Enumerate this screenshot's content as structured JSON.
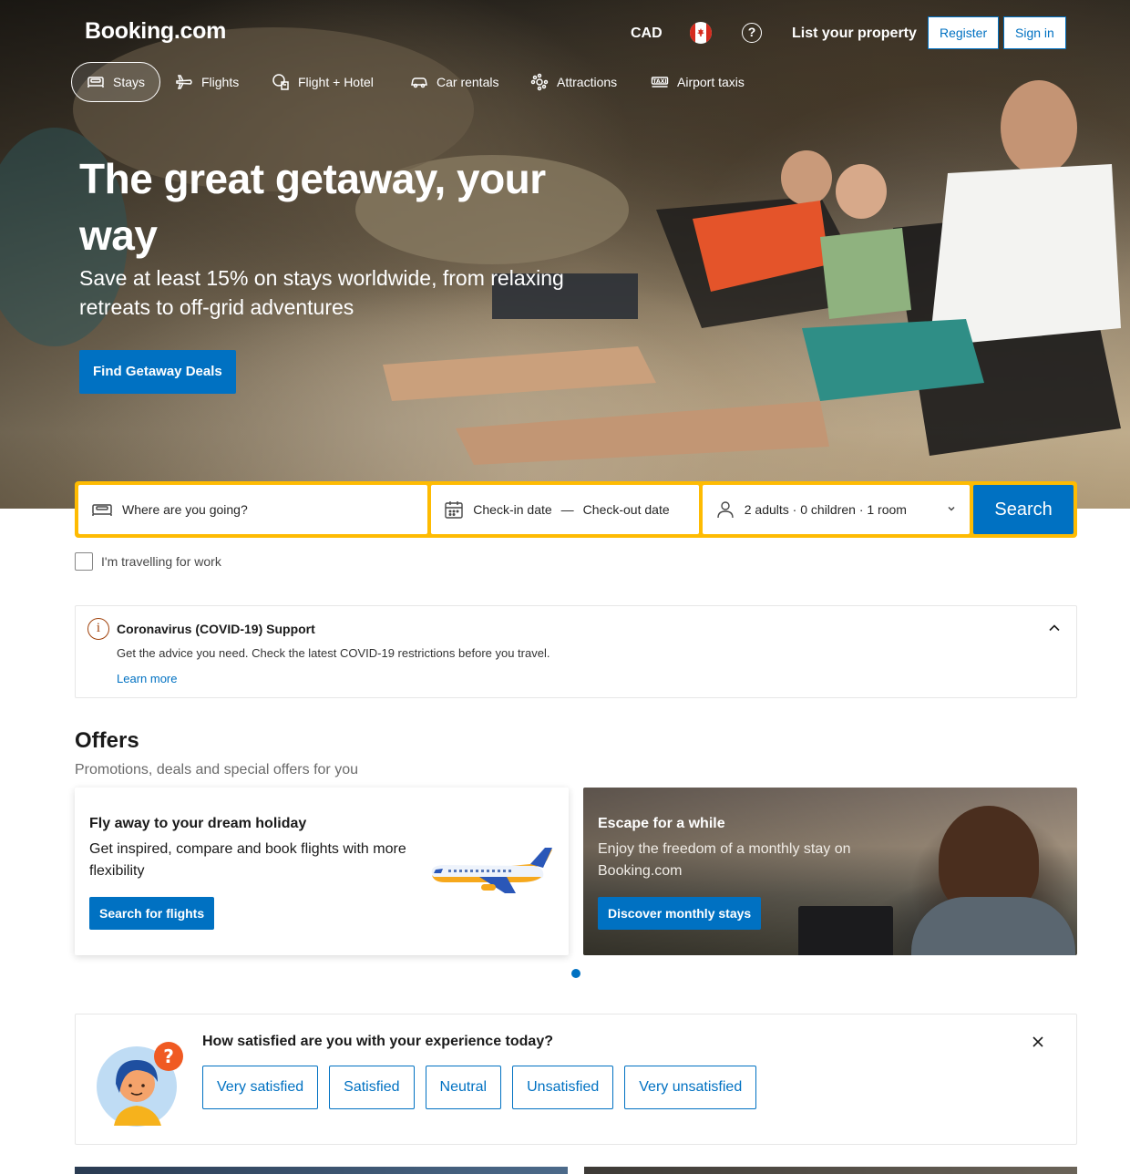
{
  "header": {
    "logo": "Booking.com",
    "currency": "CAD",
    "list_property": "List your property",
    "register": "Register",
    "sign_in": "Sign in"
  },
  "nav": {
    "items": [
      {
        "label": "Stays",
        "icon": "bed-icon",
        "active": true
      },
      {
        "label": "Flights",
        "icon": "plane-icon",
        "active": false
      },
      {
        "label": "Flight + Hotel",
        "icon": "flight-hotel-icon",
        "active": false
      },
      {
        "label": "Car rentals",
        "icon": "car-icon",
        "active": false
      },
      {
        "label": "Attractions",
        "icon": "attractions-icon",
        "active": false
      },
      {
        "label": "Airport taxis",
        "icon": "taxi-icon",
        "active": false
      }
    ]
  },
  "hero": {
    "title": "The great getaway, your way",
    "subtitle": "Save at least 15% on stays worldwide, from relaxing retreats to off-grid adventures",
    "cta": "Find Getaway Deals"
  },
  "search": {
    "destination_placeholder": "Where are you going?",
    "checkin": "Check-in date",
    "date_separator": "—",
    "checkout": "Check-out date",
    "guests": "2 adults · 0 children · 1 room",
    "button": "Search",
    "work_checkbox": "I'm travelling for work"
  },
  "covid": {
    "title": "Coronavirus (COVID-19) Support",
    "text": "Get the advice you need. Check the latest COVID-19 restrictions before you travel.",
    "link": "Learn more"
  },
  "offers": {
    "title": "Offers",
    "subtitle": "Promotions, deals and special offers for you",
    "cards": [
      {
        "heading": "Fly away to your dream holiday",
        "text": "Get inspired, compare and book flights with more flexibility",
        "button": "Search for flights"
      },
      {
        "heading": "Escape for a while",
        "text": "Enjoy the freedom of a monthly stay on Booking.com",
        "button": "Discover monthly stays"
      }
    ]
  },
  "survey": {
    "question": "How satisfied are you with your experience today?",
    "options": [
      "Very satisfied",
      "Satisfied",
      "Neutral",
      "Unsatisfied",
      "Very unsatisfied"
    ]
  },
  "colors": {
    "brand_blue": "#0071c2",
    "search_border": "#febb02",
    "covid_icon": "#a0420b"
  }
}
